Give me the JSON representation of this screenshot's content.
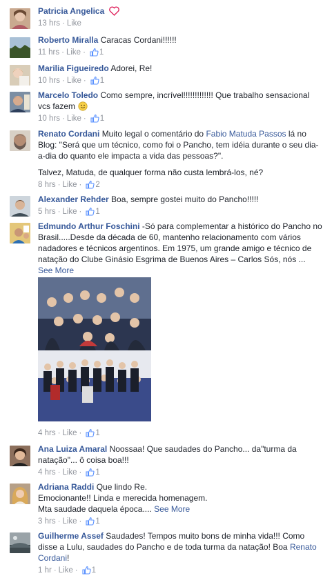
{
  "comments": [
    {
      "name": "Patricia Angelica",
      "text": "",
      "time": "13 hrs",
      "like": "Like",
      "likes": null
    },
    {
      "name": "Roberto Miralla",
      "text": "Caracas Cordani!!!!!!",
      "time": "11 hrs",
      "like": "Like",
      "likes": "1"
    },
    {
      "name": "Marilia Figueiredo",
      "text": "Adorei, Re!",
      "time": "10 hrs",
      "like": "Like",
      "likes": "1"
    },
    {
      "name": "Marcelo Toledo",
      "text": "Como sempre, incrível!!!!!!!!!!!!! Que trabalho sensacional vcs fazem",
      "time": "10 hrs",
      "like": "Like",
      "likes": "1"
    },
    {
      "name": "Renato Cordani",
      "text_a": "Muito legal o comentário do",
      "mention": "Fabio Matuda Passos",
      "text_b": "lá no Blog: \"Será que um técnico, como foi o Pancho, tem idéia durante o seu dia-a-dia do quanto ele impacta a vida das pessoas?\".",
      "text_c": "Talvez, Matuda, de qualquer forma não custa lembrá-los, né?",
      "time": "8 hrs",
      "like": "Like",
      "likes": "2"
    },
    {
      "name": "Alexander Rehder",
      "text": "Boa, sempre gostei muito do Pancho!!!!!",
      "time": "5 hrs",
      "like": "Like",
      "likes": "1"
    },
    {
      "name": "Edmundo Arthur Foschini",
      "text": "-Só para complementar a histórico do Pancho no Brasil.....Desde da década de 60, mantenho relacionamento com vários nadadores e técnicos argentinos. Em 1975, um grande amigo e técnico de natação do Clube Ginásio Esgrima de Buenos Aires – Carlos Sós, nós ...",
      "see_more": "See More",
      "time": "4 hrs",
      "like": "Like",
      "likes": "1"
    },
    {
      "name": "Ana Luiza Amaral",
      "text": "Noossaa! Que saudades do Pancho... da\"turma da natação\"... ô coisa boa!!!",
      "time": "4 hrs",
      "like": "Like",
      "likes": "1"
    },
    {
      "name": "Adriana Raddi",
      "text_a": "Que lindo Re.",
      "text_b": "Emocionante!! Linda e merecida homenagem.",
      "text_c": "Mta saudade daquela época....",
      "see_more": "See More",
      "time": "3 hrs",
      "like": "Like",
      "likes": "1"
    },
    {
      "name": "Guilherme Assef",
      "text_a": "Saudades! Tempos muito bons de minha vida!!! Como disse a Lulu, saudades do Pancho e de toda turma da natação! Boa",
      "mention": "Renato Cordani",
      "text_b": "!",
      "time": "1 hr",
      "like": "Like",
      "likes": "1"
    }
  ],
  "colors": {
    "link": "#365899",
    "meta": "#90949c",
    "heart": "#e0245e",
    "like_blue": "#5890ff"
  }
}
